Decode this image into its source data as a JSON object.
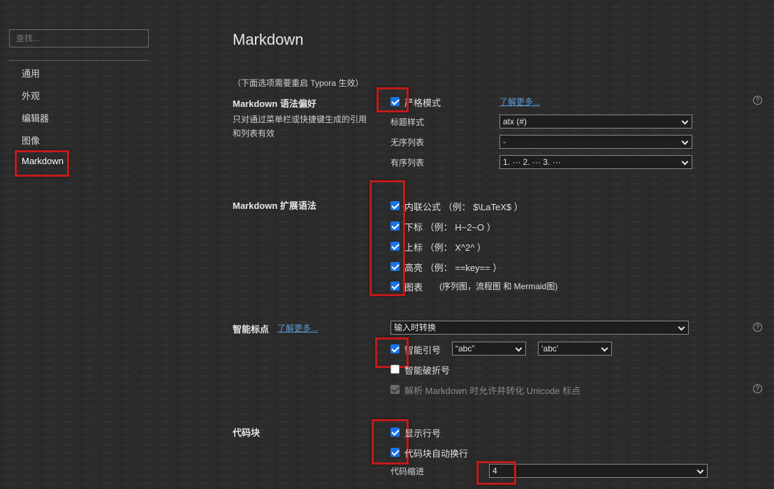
{
  "sidebar": {
    "search_placeholder": "查找...",
    "items": [
      {
        "label": "通用"
      },
      {
        "label": "外观"
      },
      {
        "label": "编辑器"
      },
      {
        "label": "图像"
      },
      {
        "label": "Markdown",
        "active": true
      }
    ]
  },
  "page": {
    "title": "Markdown",
    "note": "（下面选项需要重启 Typora 生效）"
  },
  "syntax_pref": {
    "label": "Markdown 语法偏好",
    "description": "只对通过菜单栏或快捷键生成的引用和列表有效",
    "strict_mode": {
      "label": "严格模式",
      "checked": true
    },
    "learn_more": "了解更多...",
    "heading_style": {
      "label": "标题样式",
      "value": "atx (#)"
    },
    "unordered_list": {
      "label": "无序列表",
      "value": "-"
    },
    "ordered_list": {
      "label": "有序列表",
      "value": "1. ··· 2. ··· 3. ···"
    }
  },
  "extended_syntax": {
    "label": "Markdown 扩展语法",
    "options": [
      {
        "label": "内联公式 （例： $\\LaTeX$ ）",
        "checked": true
      },
      {
        "label": "下标 （例： H~2~O ）",
        "checked": true
      },
      {
        "label": "上标 （例： X^2^ ）",
        "checked": true
      },
      {
        "label": "高亮 （例： ==key== ）",
        "checked": true
      },
      {
        "label": "图表",
        "checked": true
      }
    ],
    "diagram_note": "(序列图，流程图 和 Mermaid图)"
  },
  "smart_punct": {
    "label": "智能标点",
    "learn_more": "了解更多...",
    "mode": "输入时转换",
    "smart_quotes": {
      "label": "智能引号",
      "checked": true,
      "double": "“abc”",
      "single": "‘abc’"
    },
    "smart_dashes": {
      "label": "智能破折号",
      "checked": false
    },
    "unicode_punct": {
      "label": "解析 Markdown 时允许并转化 Unicode 标点",
      "checked": true,
      "disabled": true
    }
  },
  "code_block": {
    "label": "代码块",
    "line_numbers": {
      "label": "显示行号",
      "checked": true
    },
    "auto_wrap": {
      "label": "代码块自动换行",
      "checked": true
    },
    "indent": {
      "label": "代码缩进",
      "value": "4"
    }
  },
  "help_glyph": "?",
  "colors": {
    "background": "#2b2b2b",
    "checkbox": "#1a73e8",
    "link": "#5b9bd5",
    "highlight_box": "#c41a1a"
  }
}
